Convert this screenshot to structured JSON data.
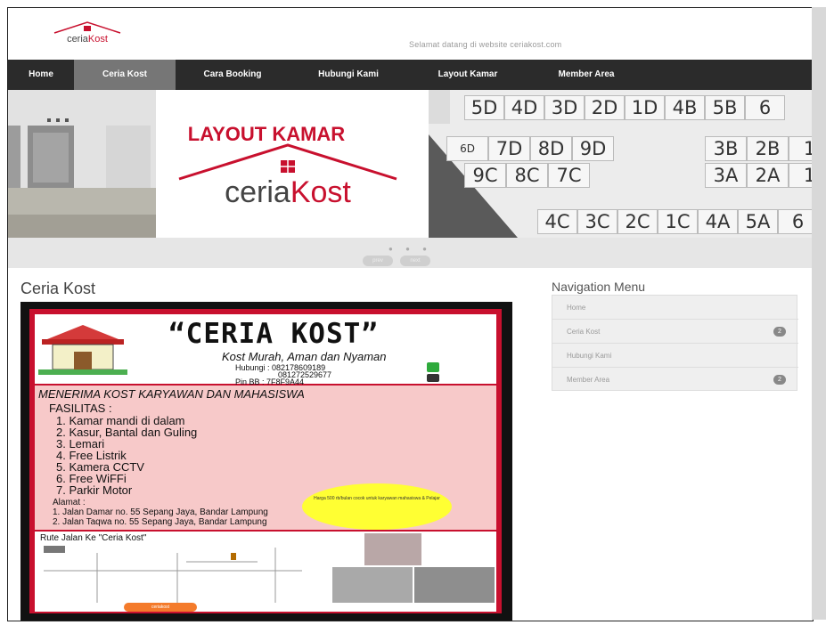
{
  "header": {
    "logo_text": "ceriaKost",
    "welcome_text": "Selamat datang di website ceriakost.com"
  },
  "nav": {
    "items": [
      {
        "label": "Home"
      },
      {
        "label": "Ceria Kost",
        "active": true
      },
      {
        "label": "Cara Booking"
      },
      {
        "label": "Hubungi Kami"
      },
      {
        "label": "Layout Kamar"
      },
      {
        "label": "Member Area"
      }
    ]
  },
  "slider": {
    "banner_title": "LAYOUT KAMAR",
    "banner_logo": "ceriaKost",
    "rooms_row1": [
      "5D",
      "4D",
      "3D",
      "2D",
      "1D",
      "4B",
      "5B",
      "6"
    ],
    "rooms_row2a": [
      "6D",
      "7D",
      "8D",
      "9D"
    ],
    "rooms_row2b": [
      "3B",
      "2B",
      "1"
    ],
    "rooms_row3a": [
      "9C",
      "8C",
      "7C"
    ],
    "rooms_row3b": [
      "3A",
      "2A",
      "1"
    ],
    "rooms_row4": [
      "4C",
      "3C",
      "2C",
      "1C",
      "4A",
      "5A",
      "6"
    ],
    "prev_label": "prev",
    "next_label": "next"
  },
  "content": {
    "title": "Ceria Kost",
    "poster": {
      "title": "“CERIA  KOST”",
      "tagline": "Kost Murah, Aman dan Nyaman",
      "phone_label": "Hubungi : 082178609189",
      "phone2": "081272529677",
      "pin": "Pin BB    : 7F8F9A44",
      "headline": "MENERIMA KOST KARYAWAN DAN MAHASISWA",
      "fasilitas_label": "FASILITAS :",
      "fasilitas": [
        "1. Kamar mandi di dalam",
        "2. Kasur, Bantal dan Guling",
        "3. Lemari",
        "4. Free Listrik",
        "5. Kamera CCTV",
        "6. Free WiFFi",
        "7. Parkir Motor"
      ],
      "alamat_label": "Alamat :",
      "alamat": [
        "1. Jalan Damar no. 55 Sepang Jaya, Bandar Lampung",
        "2. Jalan Taqwa no. 55 Sepang Jaya, Bandar Lampung"
      ],
      "bubble_text": "Harga 500 rb/bulan\ncocok untuk karyawan\nmahasiswa & Pelajar",
      "route_title": "Rute Jalan Ke \"Ceria Kost\""
    }
  },
  "sidebar": {
    "title": "Navigation Menu",
    "items": [
      {
        "label": "Home"
      },
      {
        "label": "Ceria Kost",
        "badge": "2"
      },
      {
        "label": "Hubungi Kami"
      },
      {
        "label": "Member Area",
        "badge": "2"
      }
    ]
  },
  "colors": {
    "nav_bg": "#2b2b2b",
    "nav_active": "#767676",
    "brand_red": "#c8102e"
  }
}
